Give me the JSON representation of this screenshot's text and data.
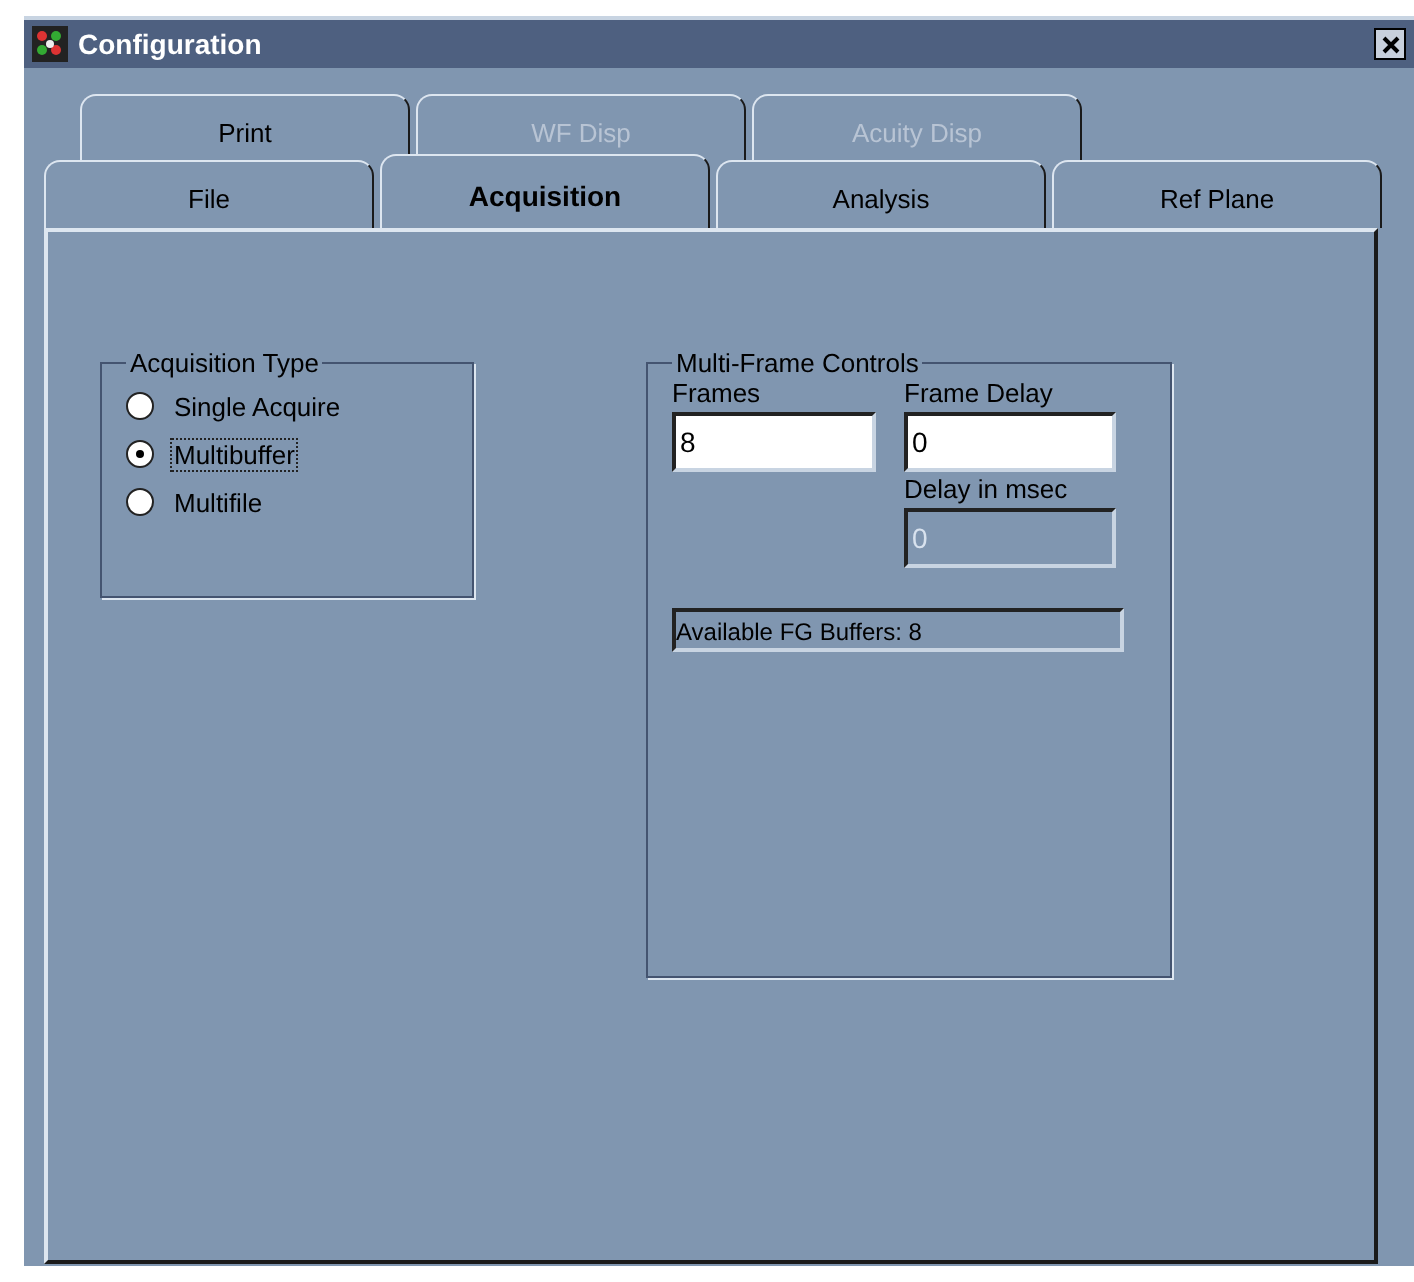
{
  "window": {
    "title": "Configuration"
  },
  "tab_rows": [
    [
      {
        "label": "Print",
        "selected": false,
        "disabled": false
      },
      {
        "label": "WF Disp",
        "selected": false,
        "disabled": true
      },
      {
        "label": "Acuity Disp",
        "selected": false,
        "disabled": true
      }
    ],
    [
      {
        "label": "File",
        "selected": false,
        "disabled": false
      },
      {
        "label": "Acquisition",
        "selected": true,
        "disabled": false
      },
      {
        "label": "Analysis",
        "selected": false,
        "disabled": false
      },
      {
        "label": "Ref Plane",
        "selected": false,
        "disabled": false
      }
    ]
  ],
  "acquisition_type": {
    "title": "Acquisition Type",
    "options": [
      {
        "label": "Single Acquire",
        "selected": false,
        "focused": false
      },
      {
        "label": "Multibuffer",
        "selected": true,
        "focused": true
      },
      {
        "label": "Multifile",
        "selected": false,
        "focused": false
      }
    ]
  },
  "multi_frame": {
    "title": "Multi-Frame Controls",
    "fields": [
      {
        "label": "Frames",
        "value": "8",
        "disabled": false
      },
      {
        "label": "Frame Delay",
        "value": "0",
        "disabled": false
      },
      {
        "label": "Delay in msec",
        "value": "0",
        "disabled": true
      }
    ],
    "status": "Available FG Buffers:  8"
  }
}
